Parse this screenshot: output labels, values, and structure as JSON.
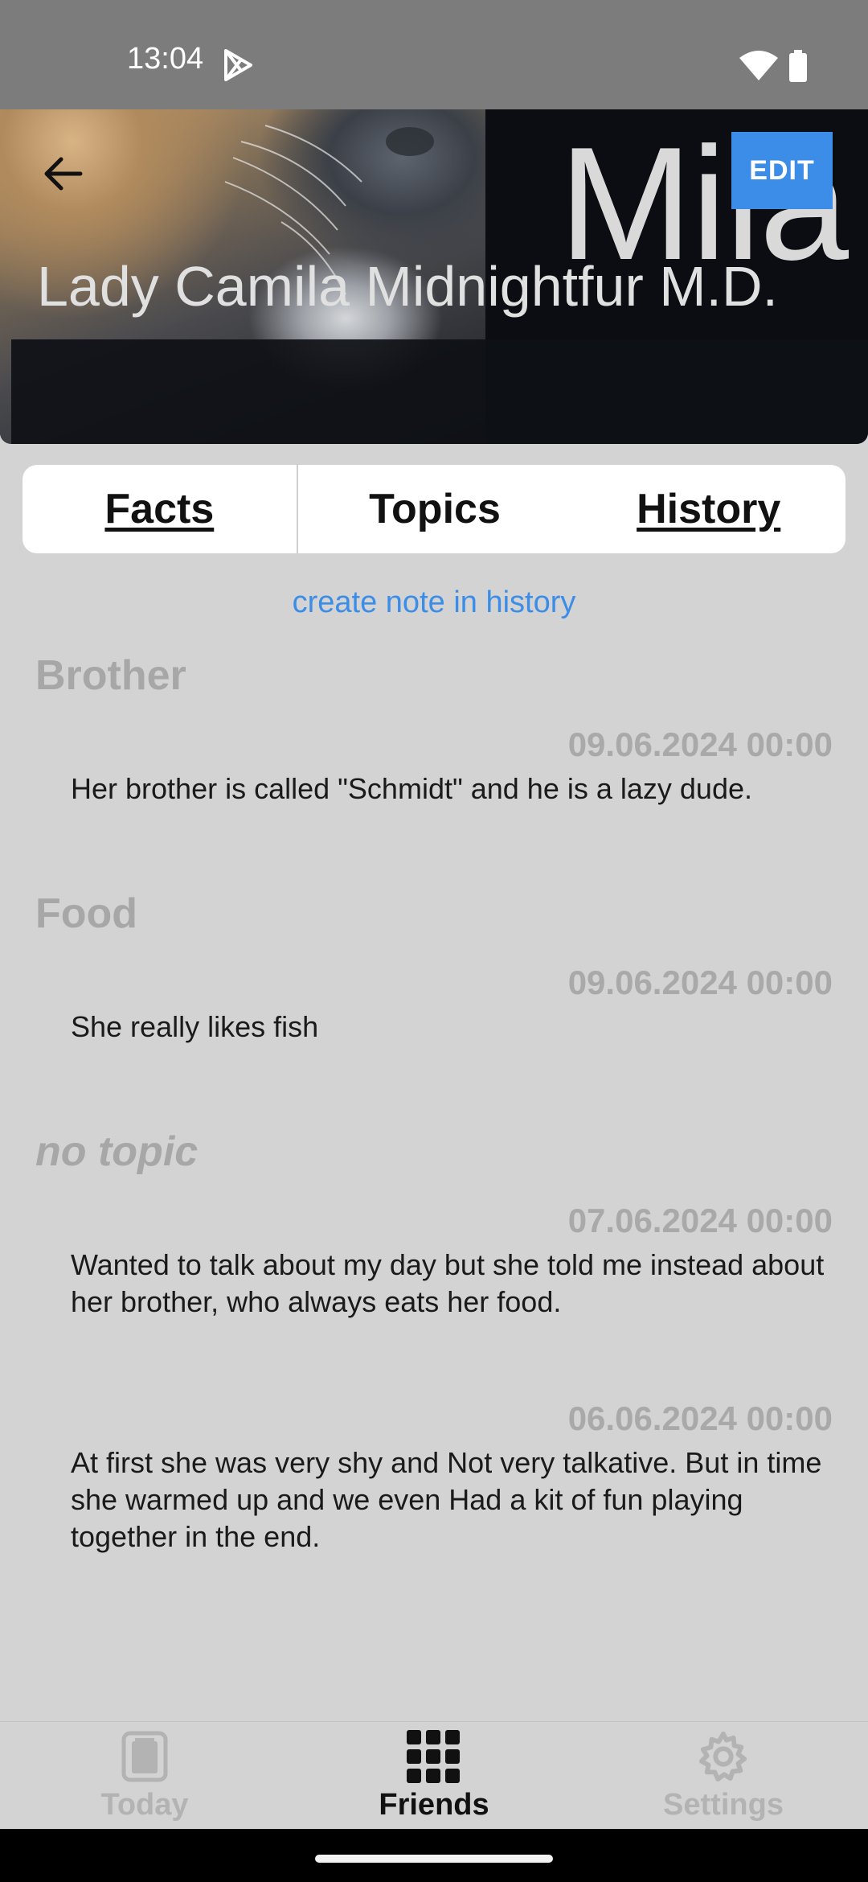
{
  "status_bar": {
    "time": "13:04"
  },
  "header": {
    "first_name": "Mila",
    "full_name": "Lady Camila Midnightfur M.D.",
    "edit_label": "EDIT"
  },
  "tabs": [
    {
      "label": "Facts"
    },
    {
      "label": "Topics"
    },
    {
      "label": "History"
    }
  ],
  "create_note_label": "create note in history",
  "notes": [
    {
      "topic": "Brother",
      "date": "09.06.2024 00:00",
      "text": "Her brother is called \"Schmidt\" and he is a lazy dude."
    },
    {
      "topic": "Food",
      "date": "09.06.2024 00:00",
      "text": "She really likes fish"
    },
    {
      "topic": "no topic",
      "date": "07.06.2024 00:00",
      "text": "Wanted to talk about my day but she told me instead about her brother, who always eats her food."
    },
    {
      "topic": "",
      "date": "06.06.2024 00:00",
      "text": "At first she was very shy and Not very talkative. But in time she warmed up and we even Had a kit of fun playing together in the end."
    }
  ],
  "bottom_nav": [
    {
      "label": "Today",
      "icon": "book-icon"
    },
    {
      "label": "Friends",
      "icon": "grid-icon"
    },
    {
      "label": "Settings",
      "icon": "gear-icon"
    }
  ],
  "colors": {
    "accent": "#3b8de8",
    "background": "#d3d3d3",
    "muted_text": "#a9a9a9"
  }
}
